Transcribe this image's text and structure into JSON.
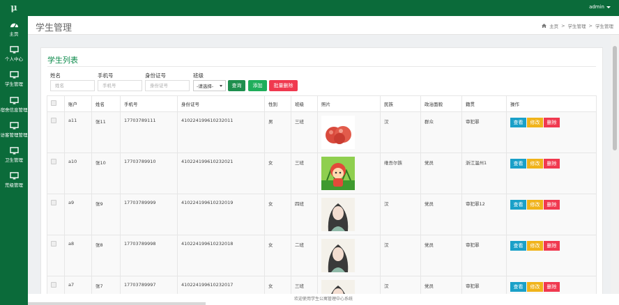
{
  "app": {
    "logo": "μ"
  },
  "user": {
    "name": "admin"
  },
  "sidebar": {
    "items": [
      {
        "label": "主页",
        "icon": "dashboard-icon"
      },
      {
        "label": "个人中心",
        "icon": "monitor-icon"
      },
      {
        "label": "学生管理",
        "icon": "monitor-icon"
      },
      {
        "label": "宿舍信息管理",
        "icon": "monitor-icon"
      },
      {
        "label": "访客管理管理",
        "icon": "monitor-icon"
      },
      {
        "label": "卫生管理",
        "icon": "monitor-icon"
      },
      {
        "label": "荒级管理",
        "icon": "monitor-icon"
      }
    ]
  },
  "header": {
    "title": "学生管理",
    "breadcrumb": [
      "主页",
      "学生管理",
      "学生管理"
    ]
  },
  "panel": {
    "title": "学生列表"
  },
  "filters": {
    "name_label": "姓名",
    "name_placeholder": "姓名",
    "phone_label": "手机号",
    "phone_placeholder": "手机号",
    "id_label": "身份证号",
    "id_placeholder": "身份证号",
    "class_label": "班级",
    "class_selected": "-请选择-",
    "search_label": "查询",
    "add_label": "添加",
    "batch_delete_label": "批量删除"
  },
  "table": {
    "columns": [
      "账户",
      "姓名",
      "手机号",
      "身份证号",
      "性别",
      "班级",
      "照片",
      "民族",
      "政治面貌",
      "籍贯",
      "操作"
    ],
    "actions": {
      "view": "查看",
      "edit": "修改",
      "delete": "删除"
    },
    "rows": [
      {
        "account": "a11",
        "name": "张11",
        "phone": "17703789111",
        "id_no": "410224199610232011",
        "gender": "男",
        "class": "三班",
        "photo": "apple-photo",
        "ethnicity": "汉",
        "political": "群众",
        "hometown": "审犯罪"
      },
      {
        "account": "a10",
        "name": "张10",
        "phone": "17703789910",
        "id_no": "410224199610232021",
        "gender": "女",
        "class": "三班",
        "photo": "cartoon-photo",
        "ethnicity": "维吾尔族",
        "political": "党员",
        "hometown": "浙江温州1"
      },
      {
        "account": "a9",
        "name": "张9",
        "phone": "17703789999",
        "id_no": "410224199610232019",
        "gender": "女",
        "class": "四班",
        "photo": "girl-photo",
        "ethnicity": "汉",
        "political": "党员",
        "hometown": "审犯罪12"
      },
      {
        "account": "a8",
        "name": "张8",
        "phone": "17703789998",
        "id_no": "410224199610232018",
        "gender": "女",
        "class": "二班",
        "photo": "girl-photo",
        "ethnicity": "汉",
        "political": "党员",
        "hometown": "审犯罪"
      },
      {
        "account": "a7",
        "name": "张7",
        "phone": "17703789997",
        "id_no": "410224199610232017",
        "gender": "女",
        "class": "三班",
        "photo": "girl-photo",
        "ethnicity": "汉",
        "political": "党员",
        "hometown": "审犯罪"
      }
    ]
  },
  "footer": {
    "text": "欢迎使用学生公寓管理中心系统"
  },
  "colors": {
    "brand": "#0b6b3a",
    "title": "#0b8a4a",
    "search_btn": "#1e8f4e",
    "add_btn": "#1fae5b",
    "danger_btn": "#f0394f",
    "view_btn": "#1aa0c8",
    "edit_btn": "#f0b31a"
  }
}
